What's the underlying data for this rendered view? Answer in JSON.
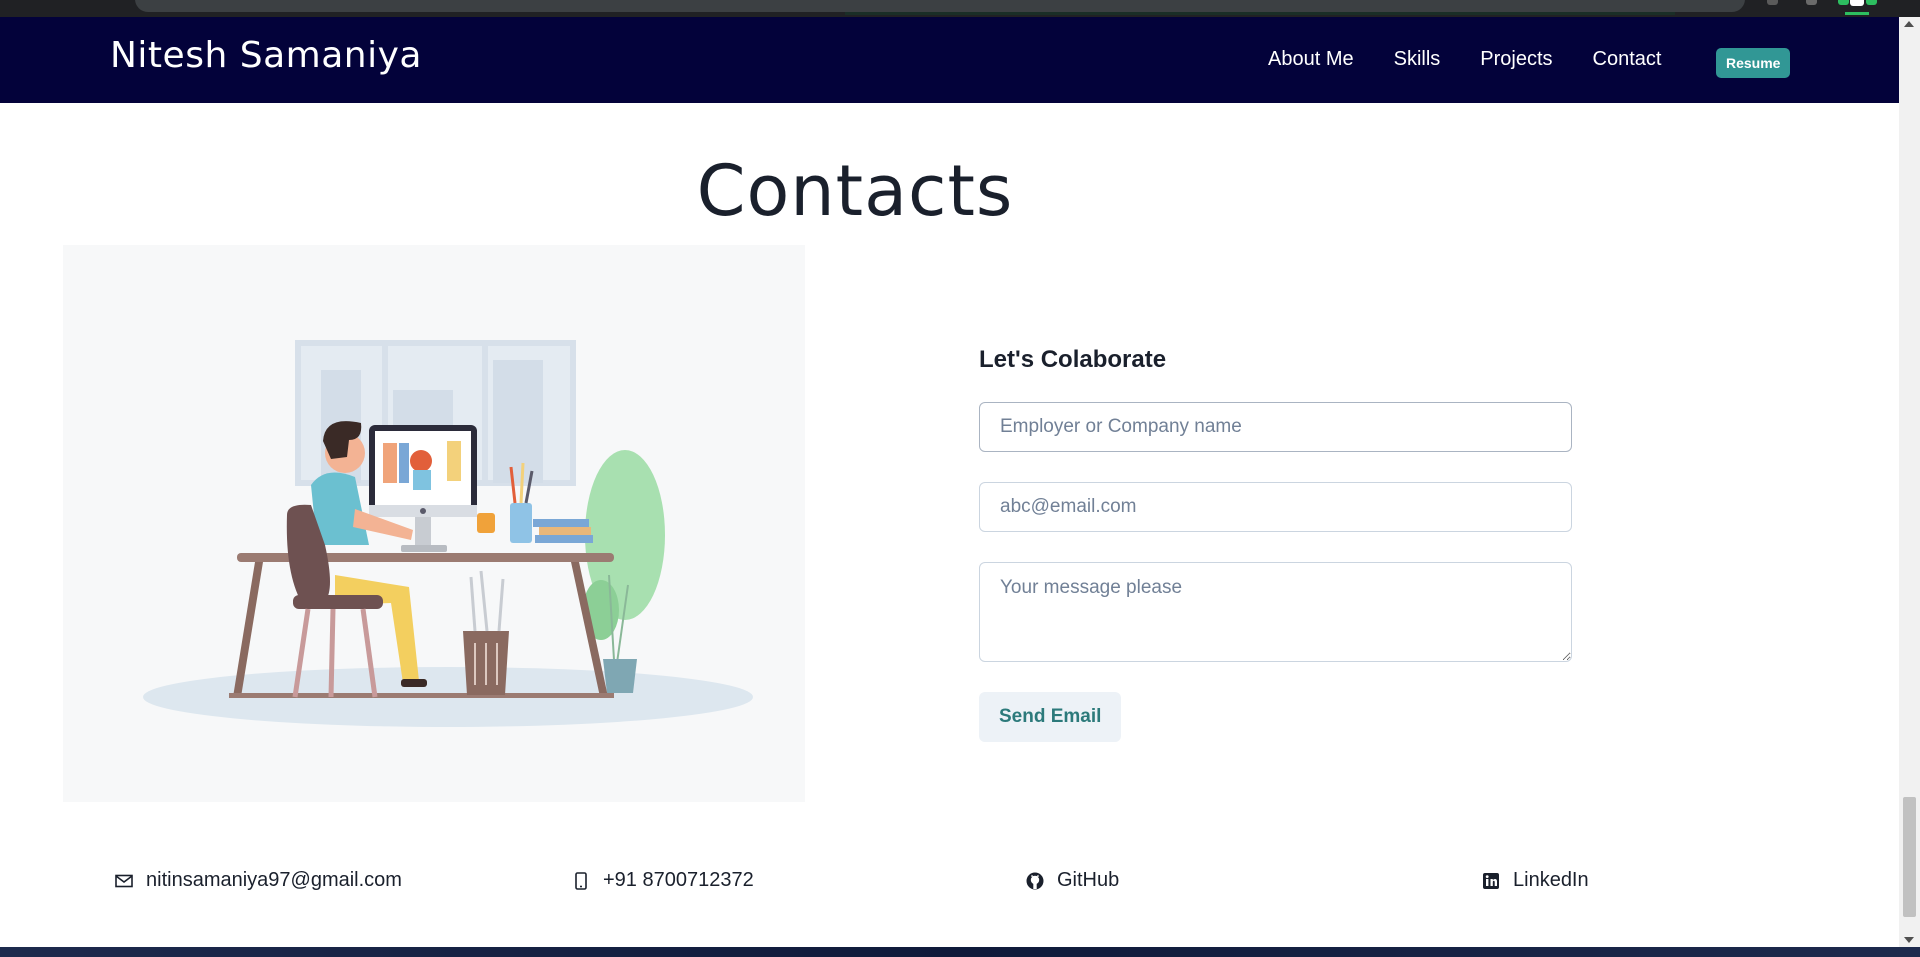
{
  "brand": {
    "name": "Nitesh Samaniya"
  },
  "nav": {
    "links": [
      "About Me",
      "Skills",
      "Projects",
      "Contact"
    ],
    "resume_label": "Resume"
  },
  "section": {
    "title": "Contacts"
  },
  "form": {
    "title": "Let's Colaborate",
    "name_placeholder": "Employer or Company name",
    "email_placeholder": "abc@email.com",
    "message_placeholder": "Your message please",
    "submit_label": "Send Email"
  },
  "footer": {
    "email": {
      "icon": "mail-icon",
      "label": "nitinsamaniya97@gmail.com"
    },
    "phone": {
      "icon": "phone-icon",
      "label": "+91 8700712372"
    },
    "github": {
      "icon": "github-icon",
      "label": "GitHub"
    },
    "linkedin": {
      "icon": "linkedin-icon",
      "label": "LinkedIn"
    }
  },
  "colors": {
    "navbar": "#03023a",
    "resume_button": "#319795",
    "send_button_text": "#2c7a7b"
  }
}
